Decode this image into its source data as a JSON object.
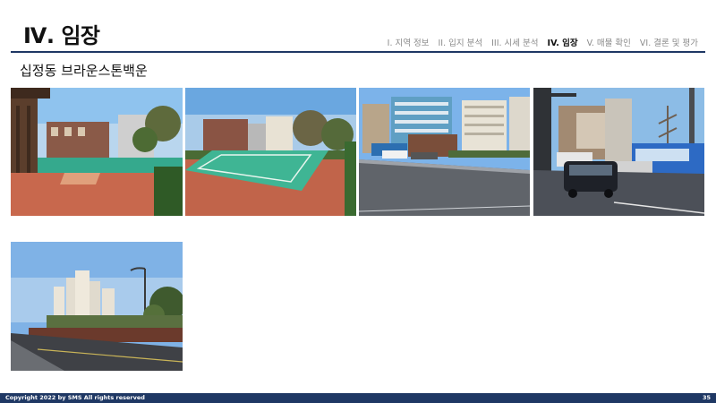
{
  "header": {
    "title": "Ⅳ. 임장",
    "nav": [
      {
        "label": "I. 지역 정보",
        "active": false
      },
      {
        "label": "II. 입지 분석",
        "active": false
      },
      {
        "label": "III. 시세 분석",
        "active": false
      },
      {
        "label": "IV. 임장",
        "active": true
      },
      {
        "label": "V. 매물 확인",
        "active": false
      },
      {
        "label": "VI. 결론 및 평가",
        "active": false
      }
    ]
  },
  "section": {
    "subtitle": "십정동 브라운스톤백운"
  },
  "colors": {
    "accent": "#1f3864",
    "nav_inactive": "#8a8a8a"
  },
  "photos": [
    {
      "id": "p1",
      "subject": "playground-court"
    },
    {
      "id": "p2",
      "subject": "sports-court"
    },
    {
      "id": "p3",
      "subject": "street-buildings"
    },
    {
      "id": "p4",
      "subject": "road-traffic-bus"
    },
    {
      "id": "p5",
      "subject": "apartment-road"
    }
  ],
  "footer": {
    "copyright": "Copyright 2022 by SMS  All rights reserved",
    "page_number": "35"
  }
}
